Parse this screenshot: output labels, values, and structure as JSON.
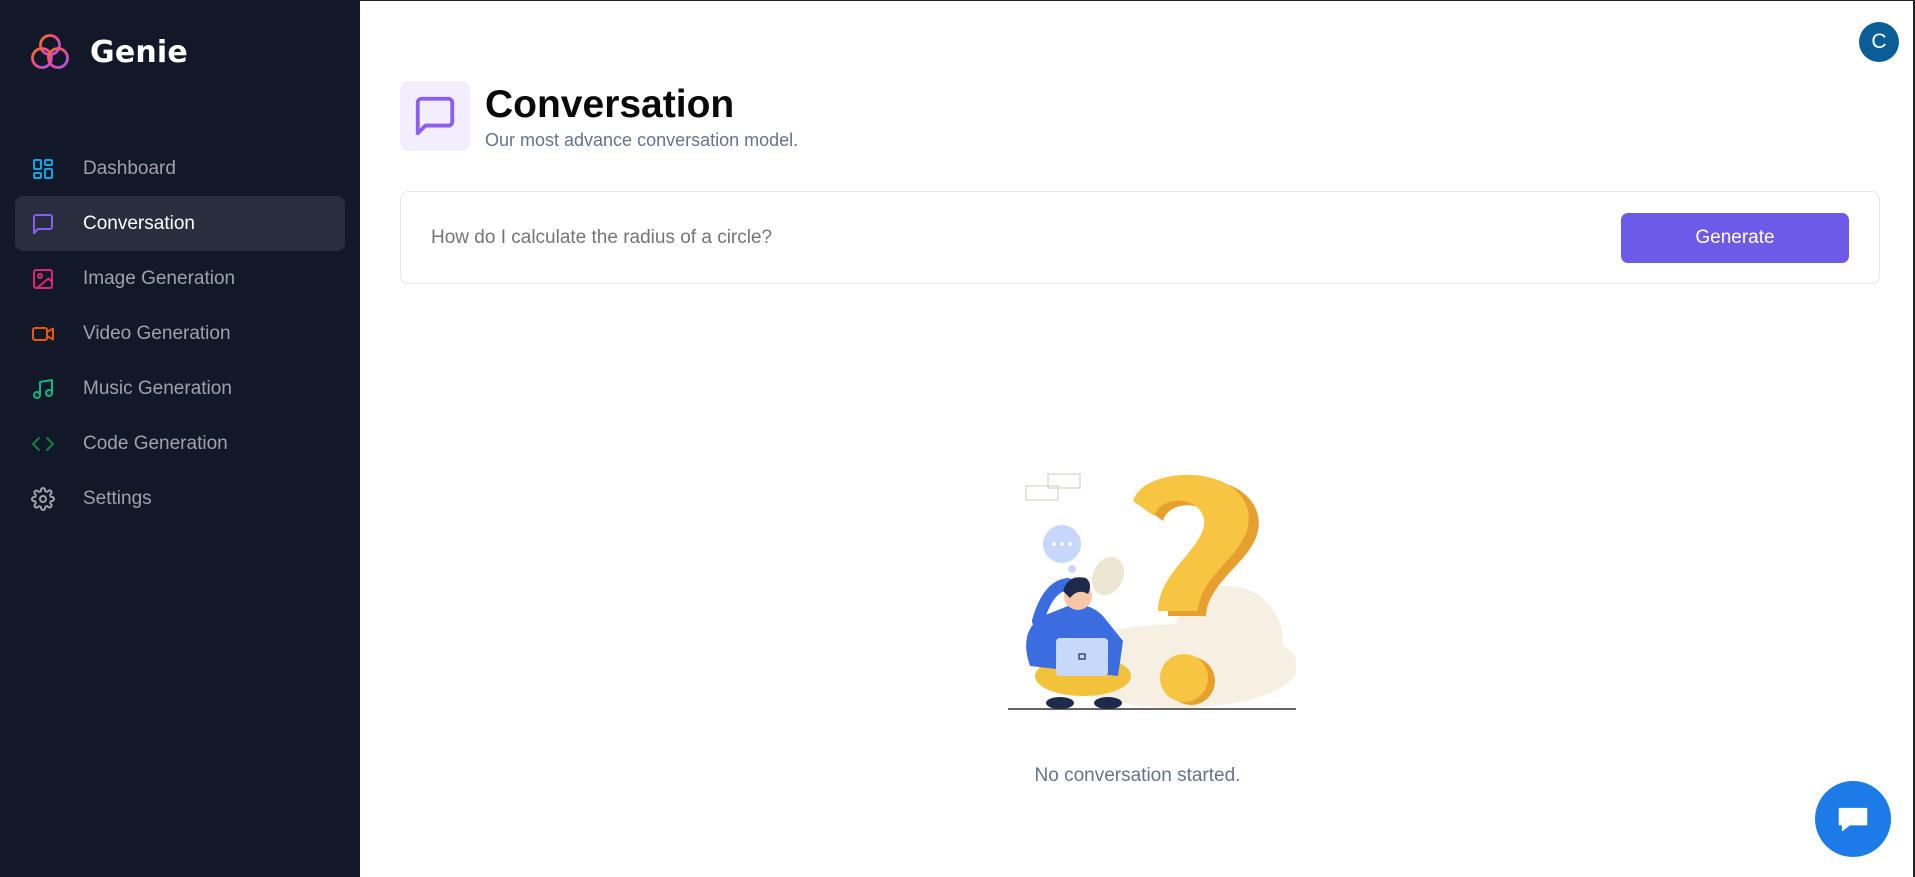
{
  "app": {
    "name": "Genie"
  },
  "sidebar": {
    "items": [
      {
        "label": "Dashboard",
        "icon": "dashboard-icon",
        "color": "#0ea5e9",
        "active": false
      },
      {
        "label": "Conversation",
        "icon": "message-square-icon",
        "color": "#8b5cf6",
        "active": true
      },
      {
        "label": "Image Generation",
        "icon": "image-icon",
        "color": "#db2777",
        "active": false
      },
      {
        "label": "Video Generation",
        "icon": "video-icon",
        "color": "#ea580c",
        "active": false
      },
      {
        "label": "Music Generation",
        "icon": "music-icon",
        "color": "#10b981",
        "active": false
      },
      {
        "label": "Code Generation",
        "icon": "code-icon",
        "color": "#15803d",
        "active": false
      },
      {
        "label": "Settings",
        "icon": "settings-icon",
        "color": "#a1a1aa",
        "active": false
      }
    ]
  },
  "user": {
    "avatar_initial": "C"
  },
  "header": {
    "title": "Conversation",
    "subtitle": "Our most advance conversation model."
  },
  "prompt": {
    "placeholder": "How do I calculate the radius of a circle?",
    "value": "",
    "button_label": "Generate"
  },
  "empty_state": {
    "message": "No conversation started."
  },
  "colors": {
    "sidebar_bg": "#111827",
    "accent": "#6d5ae6",
    "chat_fab": "#1c7be6"
  }
}
